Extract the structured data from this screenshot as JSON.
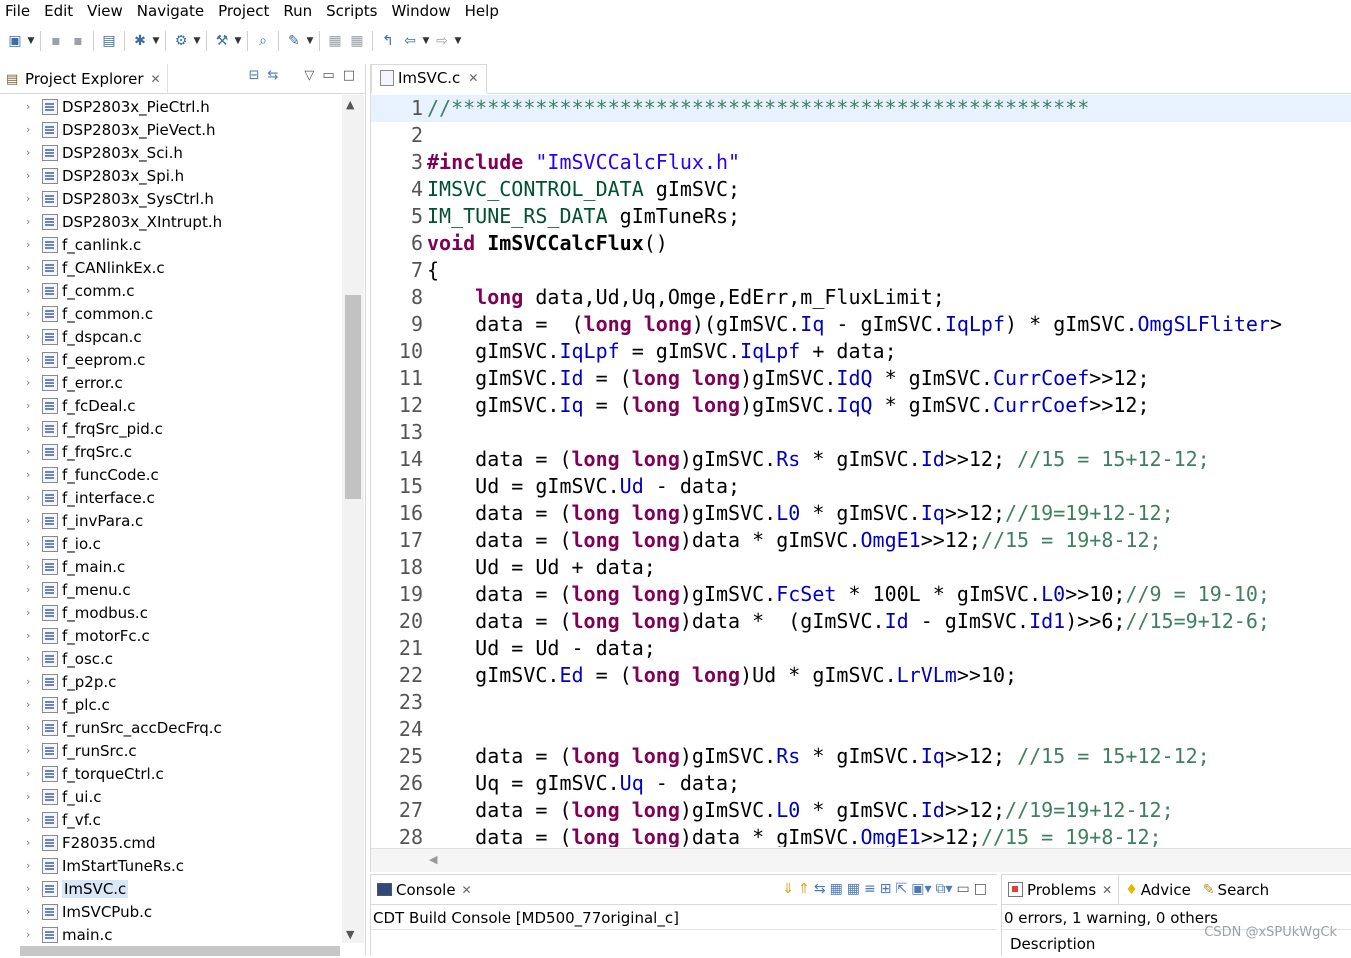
{
  "menu": [
    "File",
    "Edit",
    "View",
    "Navigate",
    "Project",
    "Run",
    "Scripts",
    "Window",
    "Help"
  ],
  "explorer": {
    "title": "Project Explorer",
    "files": [
      "DSP2803x_PieCtrl.h",
      "DSP2803x_PieVect.h",
      "DSP2803x_Sci.h",
      "DSP2803x_Spi.h",
      "DSP2803x_SysCtrl.h",
      "DSP2803x_XIntrupt.h",
      "f_canlink.c",
      "f_CANlinkEx.c",
      "f_comm.c",
      "f_common.c",
      "f_dspcan.c",
      "f_eeprom.c",
      "f_error.c",
      "f_fcDeal.c",
      "f_frqSrc_pid.c",
      "f_frqSrc.c",
      "f_funcCode.c",
      "f_interface.c",
      "f_invPara.c",
      "f_io.c",
      "f_main.c",
      "f_menu.c",
      "f_modbus.c",
      "f_motorFc.c",
      "f_osc.c",
      "f_p2p.c",
      "f_plc.c",
      "f_runSrc_accDecFrq.c",
      "f_runSrc.c",
      "f_torqueCtrl.c",
      "f_ui.c",
      "f_vf.c",
      "F28035.cmd",
      "ImStartTuneRs.c",
      "ImSVC.c",
      "ImSVCPub.c",
      "main.c"
    ],
    "selected": "ImSVC.c"
  },
  "editor": {
    "tab_label": "ImSVC.c",
    "lines": [
      {
        "n": "1",
        "t": [
          [
            "cmt",
            "//*****************************************************"
          ]
        ]
      },
      {
        "n": "2",
        "t": []
      },
      {
        "n": "3",
        "t": [
          [
            "kw",
            "#include"
          ],
          [
            "",
            " "
          ],
          [
            "str",
            "\"ImSVCCalcFlux.h\""
          ]
        ]
      },
      {
        "n": "4",
        "t": [
          [
            "ty",
            "IMSVC_CONTROL_DATA"
          ],
          [
            "",
            " gImSVC;"
          ]
        ]
      },
      {
        "n": "5",
        "t": [
          [
            "ty",
            "IM_TUNE_RS_DATA"
          ],
          [
            "",
            " gImTuneRs;"
          ]
        ]
      },
      {
        "n": "6",
        "t": [
          [
            "kw",
            "void"
          ],
          [
            "",
            " "
          ],
          [
            "b",
            "ImSVCCalcFlux"
          ],
          [
            "",
            "()"
          ]
        ]
      },
      {
        "n": "7",
        "t": [
          [
            "",
            "{"
          ]
        ]
      },
      {
        "n": "8",
        "t": [
          [
            "",
            "    "
          ],
          [
            "kw",
            "long"
          ],
          [
            "",
            " data,Ud,Uq,Omge,EdErr,m_FluxLimit;"
          ]
        ]
      },
      {
        "n": "9",
        "t": [
          [
            "",
            "    data =  ("
          ],
          [
            "kw",
            "long long"
          ],
          [
            "",
            ")(gImSVC."
          ],
          [
            "fld",
            "Iq"
          ],
          [
            "",
            " - gImSVC."
          ],
          [
            "fld",
            "IqLpf"
          ],
          [
            "",
            ") * gImSVC."
          ],
          [
            "fld",
            "OmgSLFliter"
          ],
          [
            "",
            ">"
          ]
        ]
      },
      {
        "n": "10",
        "t": [
          [
            "",
            "    gImSVC."
          ],
          [
            "fld",
            "IqLpf"
          ],
          [
            "",
            " = gImSVC."
          ],
          [
            "fld",
            "IqLpf"
          ],
          [
            "",
            " + data;"
          ]
        ]
      },
      {
        "n": "11",
        "t": [
          [
            "",
            "    gImSVC."
          ],
          [
            "fld",
            "Id"
          ],
          [
            "",
            " = ("
          ],
          [
            "kw",
            "long long"
          ],
          [
            "",
            ")gImSVC."
          ],
          [
            "fld",
            "IdQ"
          ],
          [
            "",
            " * gImSVC."
          ],
          [
            "fld",
            "CurrCoef"
          ],
          [
            "",
            ">>12;"
          ]
        ]
      },
      {
        "n": "12",
        "t": [
          [
            "",
            "    gImSVC."
          ],
          [
            "fld",
            "Iq"
          ],
          [
            "",
            " = ("
          ],
          [
            "kw",
            "long long"
          ],
          [
            "",
            ")gImSVC."
          ],
          [
            "fld",
            "IqQ"
          ],
          [
            "",
            " * gImSVC."
          ],
          [
            "fld",
            "CurrCoef"
          ],
          [
            "",
            ">>12;"
          ]
        ]
      },
      {
        "n": "13",
        "t": []
      },
      {
        "n": "14",
        "t": [
          [
            "",
            "    data = ("
          ],
          [
            "kw",
            "long long"
          ],
          [
            "",
            ")gImSVC."
          ],
          [
            "fld",
            "Rs"
          ],
          [
            "",
            " * gImSVC."
          ],
          [
            "fld",
            "Id"
          ],
          [
            "",
            ">>12; "
          ],
          [
            "cmt",
            "//15 = 15+12-12;"
          ]
        ]
      },
      {
        "n": "15",
        "t": [
          [
            "",
            "    Ud = gImSVC."
          ],
          [
            "fld",
            "Ud"
          ],
          [
            "",
            " - data;"
          ]
        ]
      },
      {
        "n": "16",
        "t": [
          [
            "",
            "    data = ("
          ],
          [
            "kw",
            "long long"
          ],
          [
            "",
            ")gImSVC."
          ],
          [
            "fld",
            "L0"
          ],
          [
            "",
            " * gImSVC."
          ],
          [
            "fld",
            "Iq"
          ],
          [
            "",
            ">>12;"
          ],
          [
            "cmt",
            "//19=19+12-12;"
          ]
        ]
      },
      {
        "n": "17",
        "t": [
          [
            "",
            "    data = ("
          ],
          [
            "kw",
            "long long"
          ],
          [
            "",
            ")data * gImSVC."
          ],
          [
            "fld",
            "OmgE1"
          ],
          [
            "",
            ">>12;"
          ],
          [
            "cmt",
            "//15 = 19+8-12;"
          ]
        ]
      },
      {
        "n": "18",
        "t": [
          [
            "",
            "    Ud = Ud + data;"
          ]
        ]
      },
      {
        "n": "19",
        "t": [
          [
            "",
            "    data = ("
          ],
          [
            "kw",
            "long long"
          ],
          [
            "",
            ")gImSVC."
          ],
          [
            "fld",
            "FcSet"
          ],
          [
            "",
            " * 100L * gImSVC."
          ],
          [
            "fld",
            "L0"
          ],
          [
            "",
            ">>10;"
          ],
          [
            "cmt",
            "//9 = 19-10;"
          ]
        ]
      },
      {
        "n": "20",
        "t": [
          [
            "",
            "    data = ("
          ],
          [
            "kw",
            "long long"
          ],
          [
            "",
            ")data *  (gImSVC."
          ],
          [
            "fld",
            "Id"
          ],
          [
            "",
            " - gImSVC."
          ],
          [
            "fld",
            "Id1"
          ],
          [
            "",
            ")>>6;"
          ],
          [
            "cmt",
            "//15=9+12-6;"
          ]
        ]
      },
      {
        "n": "21",
        "t": [
          [
            "",
            "    Ud = Ud - data;"
          ]
        ]
      },
      {
        "n": "22",
        "t": [
          [
            "",
            "    gImSVC."
          ],
          [
            "fld",
            "Ed"
          ],
          [
            "",
            " = ("
          ],
          [
            "kw",
            "long long"
          ],
          [
            "",
            ")Ud * gImSVC."
          ],
          [
            "fld",
            "LrVLm"
          ],
          [
            "",
            ">>10;"
          ]
        ]
      },
      {
        "n": "23",
        "t": []
      },
      {
        "n": "24",
        "t": []
      },
      {
        "n": "25",
        "t": [
          [
            "",
            "    data = ("
          ],
          [
            "kw",
            "long long"
          ],
          [
            "",
            ")gImSVC."
          ],
          [
            "fld",
            "Rs"
          ],
          [
            "",
            " * gImSVC."
          ],
          [
            "fld",
            "Iq"
          ],
          [
            "",
            ">>12; "
          ],
          [
            "cmt",
            "//15 = 15+12-12;"
          ]
        ]
      },
      {
        "n": "26",
        "t": [
          [
            "",
            "    Uq = gImSVC."
          ],
          [
            "fld",
            "Uq"
          ],
          [
            "",
            " - data;"
          ]
        ]
      },
      {
        "n": "27",
        "t": [
          [
            "",
            "    data = ("
          ],
          [
            "kw",
            "long long"
          ],
          [
            "",
            ")gImSVC."
          ],
          [
            "fld",
            "L0"
          ],
          [
            "",
            " * gImSVC."
          ],
          [
            "fld",
            "Id"
          ],
          [
            "",
            ">>12;"
          ],
          [
            "cmt",
            "//19=19+12-12;"
          ]
        ]
      },
      {
        "n": "28",
        "t": [
          [
            "",
            "    data = ("
          ],
          [
            "kw",
            "long long"
          ],
          [
            "",
            ")data * gImSVC."
          ],
          [
            "fld",
            "OmgE1"
          ],
          [
            "",
            ">>12;"
          ],
          [
            "cmt",
            "//15 = 19+8-12;"
          ]
        ]
      }
    ]
  },
  "console": {
    "tab_label": "Console",
    "build_console": "CDT Build Console [MD500_77original_c]"
  },
  "problems": {
    "tabs": [
      "Problems",
      "Advice",
      "Search"
    ],
    "summary": "0 errors, 1 warning, 0 others",
    "column": "Description"
  },
  "watermark": "CSDN @xSPUkWgCk"
}
